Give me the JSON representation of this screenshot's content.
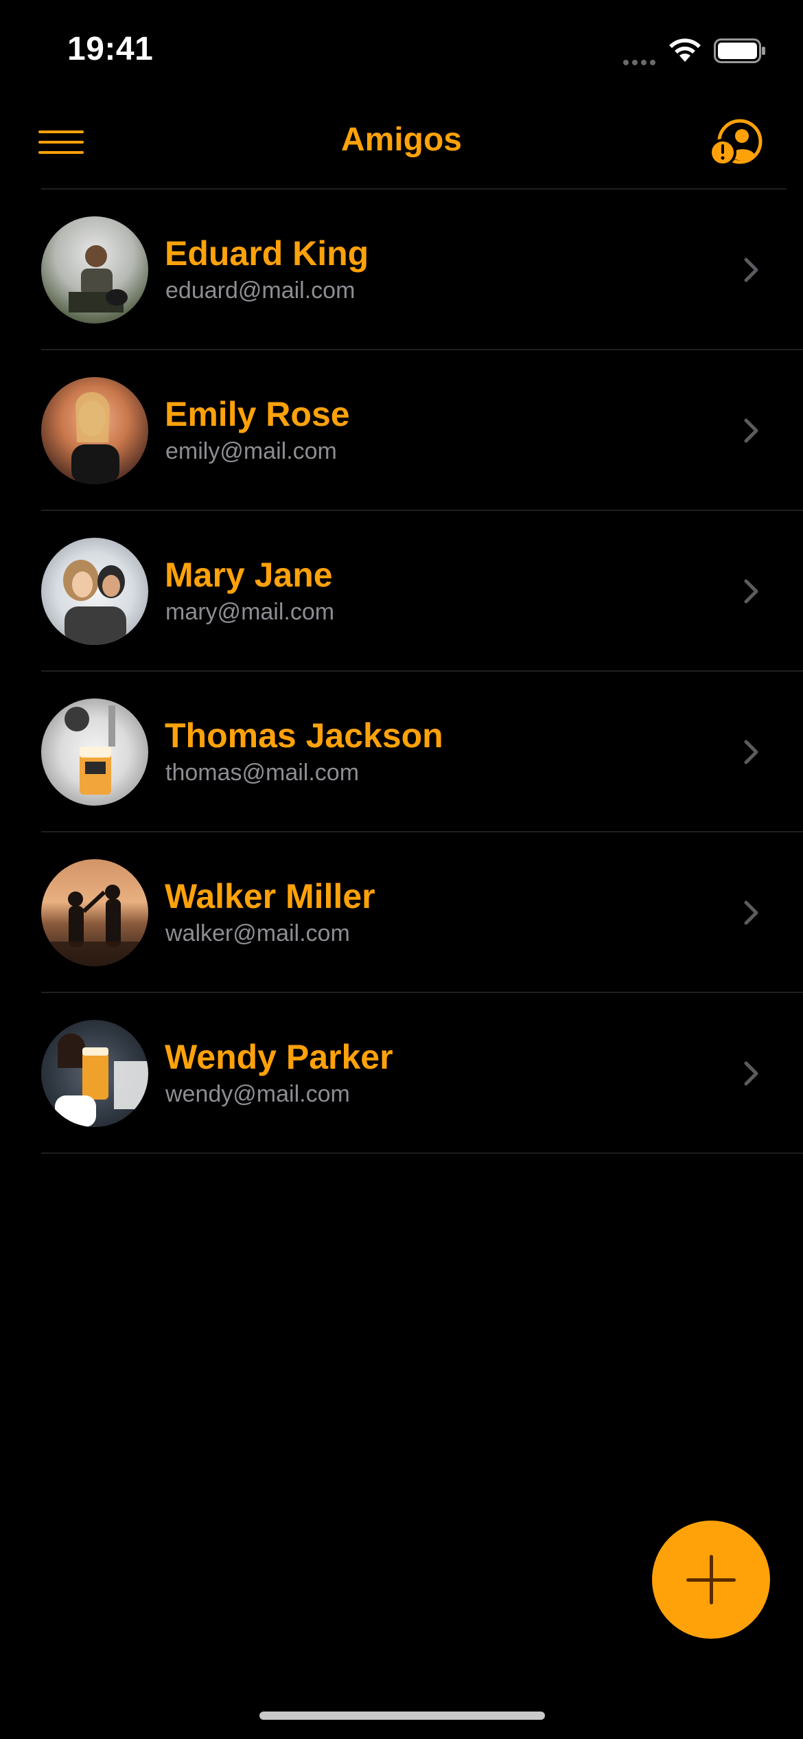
{
  "status_bar": {
    "time": "19:41"
  },
  "nav": {
    "title": "Amigos",
    "menu_icon": "hamburger-menu-icon",
    "right_icon": "person-alert-icon"
  },
  "colors": {
    "accent": "#FFA20A",
    "secondary_text": "#8d8d93",
    "background": "#000000"
  },
  "friends": [
    {
      "name": "Eduard King",
      "email": "eduard@mail.com"
    },
    {
      "name": "Emily Rose",
      "email": "emily@mail.com"
    },
    {
      "name": "Mary Jane",
      "email": "mary@mail.com"
    },
    {
      "name": "Thomas Jackson",
      "email": "thomas@mail.com"
    },
    {
      "name": "Walker Miller",
      "email": "walker@mail.com"
    },
    {
      "name": "Wendy Parker",
      "email": "wendy@mail.com"
    }
  ],
  "fab": {
    "icon": "plus-icon"
  }
}
